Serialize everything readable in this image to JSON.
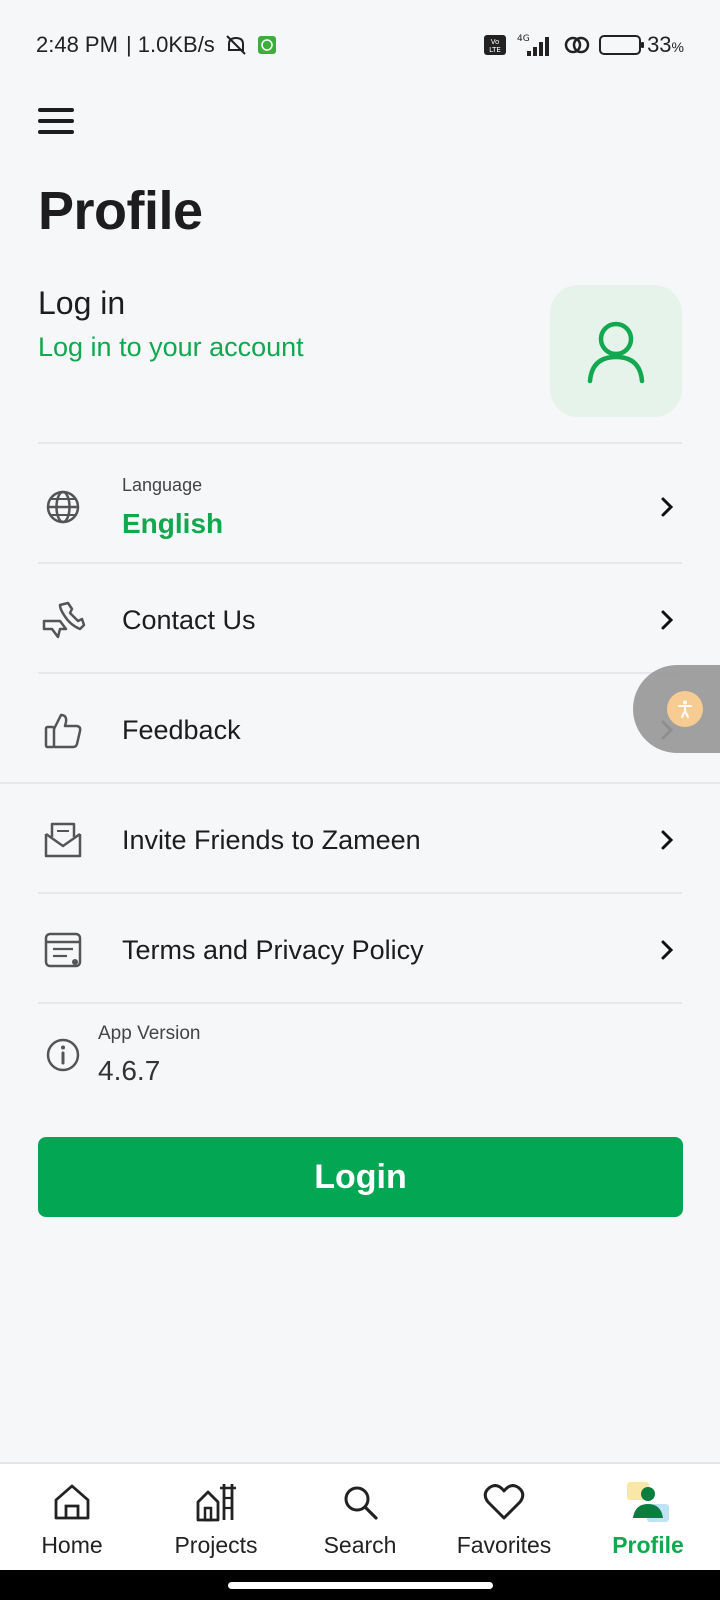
{
  "status": {
    "time": "2:48 PM",
    "network_speed": "| 1.0KB/s",
    "net_type": "4G",
    "volte": "Vo LTE",
    "battery_percent_text": "33",
    "battery_percent_unit": "%",
    "battery_level": 0.33
  },
  "header": {
    "title": "Profile"
  },
  "login_card": {
    "title": "Log in",
    "subtitle": "Log in to your account"
  },
  "settings": {
    "language_caption": "Language",
    "language_value": "English",
    "contact": "Contact Us",
    "feedback": "Feedback",
    "invite": "Invite Friends to Zameen",
    "terms": "Terms and Privacy Policy",
    "version_caption": "App Version",
    "version_value": "4.6.7"
  },
  "login_button": "Login",
  "bottom_nav": {
    "items": [
      {
        "label": "Home",
        "icon": "home-icon"
      },
      {
        "label": "Projects",
        "icon": "projects-icon"
      },
      {
        "label": "Search",
        "icon": "search-icon"
      },
      {
        "label": "Favorites",
        "icon": "heart-icon"
      },
      {
        "label": "Profile",
        "icon": "profile-icon",
        "active": true
      }
    ]
  },
  "colors": {
    "accent": "#03a653",
    "accent_text": "#11a84f",
    "avatar_bg": "#e5f3ea",
    "background": "#f6f7f9"
  }
}
